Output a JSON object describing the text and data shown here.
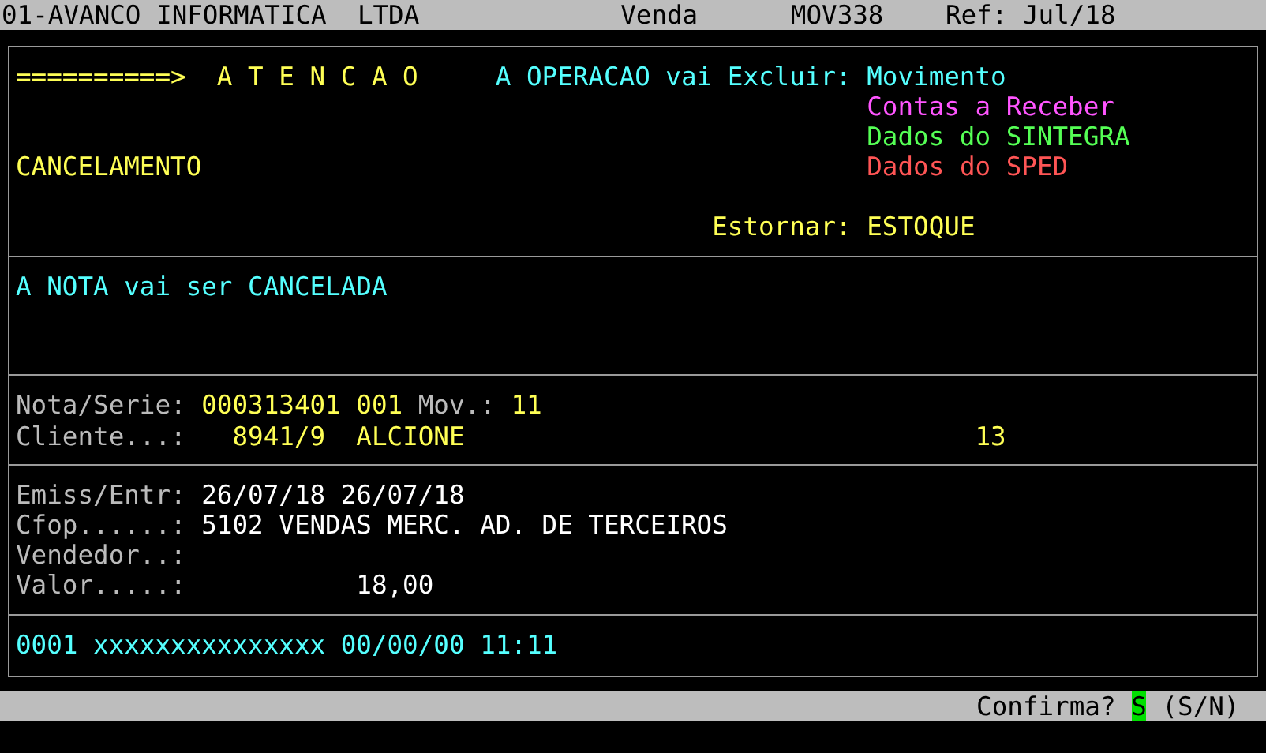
{
  "title_bar": {
    "company": "01-AVANCO INFORMATICA  LTDA",
    "module": "Venda",
    "program": "MOV338",
    "reference": "Ref: Jul/18"
  },
  "warning": {
    "arrow": "==========>",
    "title": "A T E N C A O",
    "delete_label": "A OPERACAO vai Excluir:",
    "delete_items": [
      {
        "text": "Movimento",
        "color": "#55ffff"
      },
      {
        "text": "Contas a Receber",
        "color": "#ff55ff"
      },
      {
        "text": "Dados do SINTEGRA",
        "color": "#55ff55"
      },
      {
        "text": "Dados do SPED",
        "color": "#ff5555"
      }
    ],
    "operation": "CANCELAMENTO",
    "reverse_label": "Estornar:",
    "reverse_value": "ESTOQUE"
  },
  "message": "A NOTA vai ser CANCELADA",
  "invoice": {
    "nota_label": "Nota/Serie:",
    "number": "000313401",
    "series": "001",
    "mov_label": "Mov.:",
    "mov": "11",
    "client_label": "Cliente...:",
    "client_code": "8941/9",
    "client_name": "ALCIONE",
    "column_3": "13"
  },
  "details": {
    "dates_label": "Emiss/Entr:",
    "issue_date": "26/07/18",
    "entry_date": "26/07/18",
    "cfop_label": "Cfop......:",
    "cfop": "5102 VENDAS MERC. AD. DE TERCEIROS",
    "seller_label": "Vendedor..:",
    "value_label": "Valor.....:",
    "value": "18,00"
  },
  "log": "0001 xxxxxxxxxxxxxxx 00/00/00 11:11",
  "status_bar": {
    "prompt": "Confirma?",
    "answer": "S",
    "options": "(S/N)"
  }
}
